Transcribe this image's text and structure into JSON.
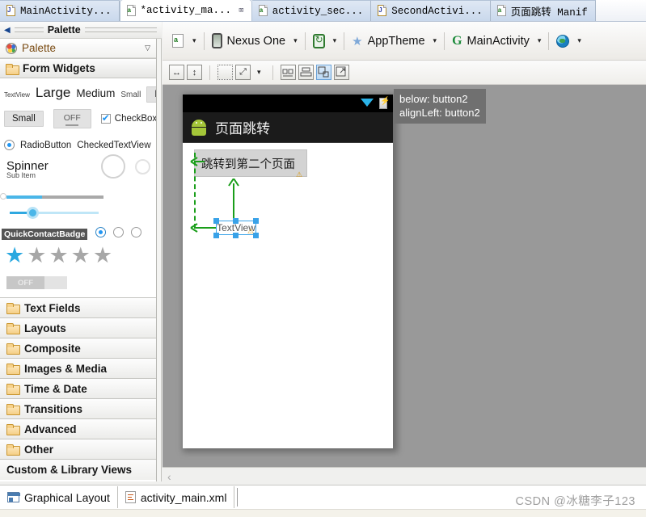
{
  "editor_tabs": [
    {
      "label": "MainActivity...",
      "icon": "java-file-icon",
      "state": "inactive",
      "closable": false
    },
    {
      "label": "*activity_ma...",
      "icon": "xml-layout-file-icon",
      "state": "active",
      "closable": true,
      "close_glyph": "⌧"
    },
    {
      "label": "activity_sec...",
      "icon": "xml-layout-file-icon",
      "state": "inactive",
      "closable": false
    },
    {
      "label": "SecondActivi...",
      "icon": "java-file-icon",
      "state": "inactive",
      "closable": false
    },
    {
      "label": "页面跳转 Manif",
      "icon": "xml-layout-file-icon",
      "state": "inactive",
      "closable": false
    }
  ],
  "palette_header": {
    "title": "Palette",
    "collapse_glyph": "◀"
  },
  "palette": {
    "title_row": {
      "label": "Palette",
      "icon": "palette-icon",
      "chevron": "▽"
    },
    "group_header": {
      "label": "Form Widgets",
      "icon": "folder-icon"
    },
    "widgets": {
      "textview_tiny": "TextView",
      "textview_large": "Large",
      "textview_medium": "Medium",
      "textview_small": "Small",
      "button": "Button",
      "small_button": "Small",
      "toggle_button": "OFF",
      "checkbox": "CheckBox",
      "radio_button": "RadioButton",
      "checked_textview": "CheckedTextView",
      "spinner": "Spinner",
      "spinner_sub": "Sub Item",
      "quick_contact_badge": "QuickContactBadge",
      "switch_off": "OFF",
      "rating_stars_total": 5,
      "rating_stars_filled": 1
    },
    "groups": [
      {
        "label": "Text Fields",
        "icon": "folder-icon"
      },
      {
        "label": "Layouts",
        "icon": "folder-icon"
      },
      {
        "label": "Composite",
        "icon": "folder-icon"
      },
      {
        "label": "Images & Media",
        "icon": "folder-icon"
      },
      {
        "label": "Time & Date",
        "icon": "folder-icon"
      },
      {
        "label": "Transitions",
        "icon": "folder-icon"
      },
      {
        "label": "Advanced",
        "icon": "folder-icon"
      },
      {
        "label": "Other",
        "icon": "folder-icon"
      }
    ],
    "custom_views": "Custom & Library Views"
  },
  "toolbar": {
    "config_label": "",
    "device": "Nexus One",
    "orientation_label": "",
    "theme": "AppTheme",
    "activity": "MainActivity",
    "locale_label": "",
    "caret": "▾",
    "icons": {
      "config": "layout-config-icon",
      "device": "device-phone-icon",
      "orientation": "orientation-rotate-icon",
      "theme": "theme-star-icon",
      "activity": "activity-g-icon",
      "locale": "globe-icon"
    }
  },
  "toolbar2": {
    "buttons": [
      {
        "name": "match-width-button",
        "glyph": "↔",
        "selected": false
      },
      {
        "name": "match-height-button",
        "glyph": "↕",
        "selected": false
      },
      {
        "name": "marquee-select-button",
        "glyph": "",
        "selected": false
      },
      {
        "name": "zoom-fit-button",
        "glyph": "⤢",
        "selected": false
      },
      {
        "name": "zoom-dropdown-caret",
        "glyph": "▾",
        "selected": false
      },
      {
        "name": "distribute-horizontal-button",
        "glyph": "",
        "selected": false
      },
      {
        "name": "align-center-button",
        "glyph": "",
        "selected": false
      },
      {
        "name": "relative-layout-button",
        "glyph": "",
        "selected": true
      },
      {
        "name": "expand-layout-button",
        "glyph": "",
        "selected": false
      }
    ]
  },
  "canvas": {
    "device_title": "页面跳转",
    "button_label": "跳转到第二个页面",
    "textview_label": "TextView",
    "tooltip_lines": [
      "below: button2",
      "alignLeft: button2"
    ],
    "warning_glyph": "⚠"
  },
  "bottom_tabs": [
    {
      "label": "Graphical Layout",
      "icon": "graphical-layout-icon",
      "active": false
    },
    {
      "label": "activity_main.xml",
      "icon": "xml-source-icon",
      "active": true
    }
  ],
  "watermark": "CSDN @冰糖李子123",
  "colors": {
    "accent_blue": "#39a2e8",
    "constraint_green": "#1a9e1a",
    "canvas_gray": "#999999",
    "tooltip_bg": "#707070",
    "android_green": "#a4c639"
  }
}
